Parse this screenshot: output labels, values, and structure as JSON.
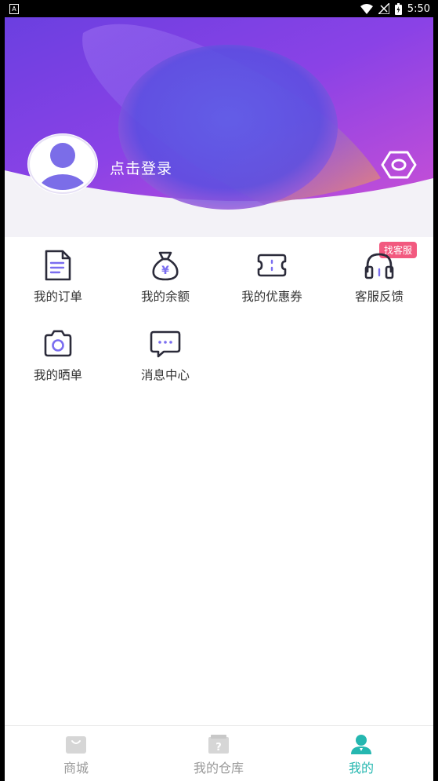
{
  "status_bar": {
    "time": "5:50",
    "notification_icon": "A"
  },
  "profile": {
    "login_text": "点击登录"
  },
  "menu": {
    "badge": "找客服",
    "items": [
      {
        "label": "我的订单",
        "icon": "document-icon"
      },
      {
        "label": "我的余额",
        "icon": "money-bag-icon"
      },
      {
        "label": "我的优惠券",
        "icon": "coupon-icon"
      },
      {
        "label": "客服反馈",
        "icon": "headset-icon"
      },
      {
        "label": "我的晒单",
        "icon": "camera-icon"
      },
      {
        "label": "消息中心",
        "icon": "message-icon"
      }
    ]
  },
  "tabbar": {
    "tabs": [
      {
        "label": "商城",
        "icon": "shop-bag-icon",
        "active": false
      },
      {
        "label": "我的仓库",
        "icon": "warehouse-box-icon",
        "active": false
      },
      {
        "label": "我的",
        "icon": "user-icon",
        "active": true
      }
    ]
  },
  "colors": {
    "header_purple": "#7b3fe6",
    "header_pink": "#d95cc9",
    "active_tab": "#25b7b0",
    "icon_dark": "#2b2b3a",
    "icon_accent": "#7a6df0",
    "badge": "#f2597f"
  }
}
